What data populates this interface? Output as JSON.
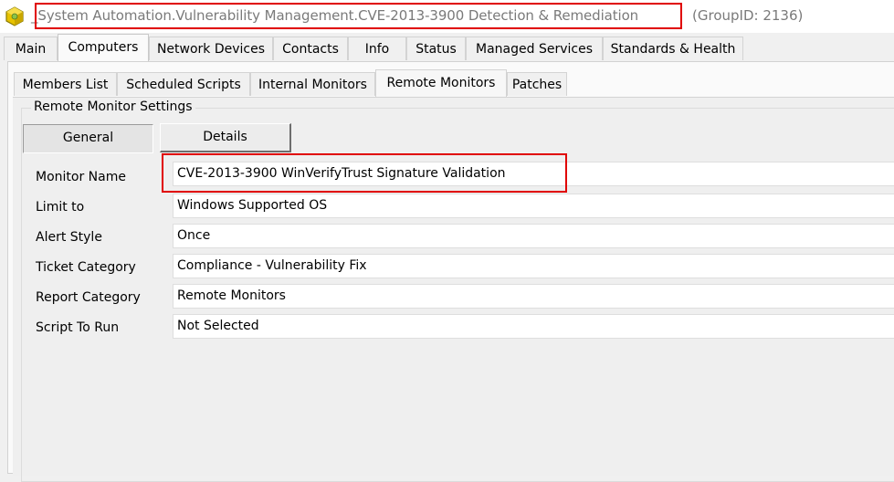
{
  "window": {
    "title": "_System Automation.Vulnerability Management.CVE-2013-3900 Detection & Remediation",
    "group_id": "(GroupID: 2136)",
    "icon": "group-folder-icon"
  },
  "main_tabs": [
    {
      "label": "Main"
    },
    {
      "label": "Computers",
      "active": true
    },
    {
      "label": "Network Devices"
    },
    {
      "label": "Contacts"
    },
    {
      "label": "Info"
    },
    {
      "label": "Status"
    },
    {
      "label": "Managed Services"
    },
    {
      "label": "Standards & Health"
    }
  ],
  "sub_tabs": [
    {
      "label": "Members List"
    },
    {
      "label": "Scheduled Scripts"
    },
    {
      "label": "Internal Monitors"
    },
    {
      "label": "Remote Monitors",
      "active": true
    },
    {
      "label": "Patches"
    }
  ],
  "settings": {
    "group_title": "Remote Monitor Settings",
    "buttons": [
      {
        "label": "General",
        "active": true
      },
      {
        "label": "Details"
      }
    ],
    "fields": [
      {
        "label": "Monitor Name",
        "value": "CVE-2013-3900 WinVerifyTrust Signature Validation"
      },
      {
        "label": "Limit to",
        "value": "Windows Supported OS"
      },
      {
        "label": "Alert Style",
        "value": "Once"
      },
      {
        "label": "Ticket Category",
        "value": "Compliance - Vulnerability Fix"
      },
      {
        "label": "Report Category",
        "value": "Remote Monitors"
      },
      {
        "label": "Script To Run",
        "value": "Not Selected"
      }
    ]
  },
  "colors": {
    "highlight": "#e00000",
    "background": "#f0f0f0"
  }
}
